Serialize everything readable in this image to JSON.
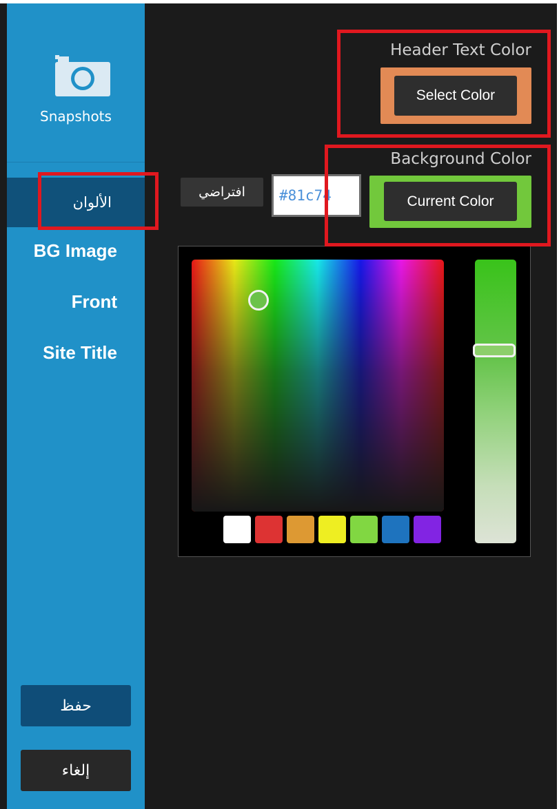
{
  "sidebar": {
    "snapshots_label": "Snapshots",
    "items": [
      {
        "label": "الألوان",
        "active": true
      },
      {
        "label": "BG Image",
        "active": false
      },
      {
        "label": "Front",
        "active": false
      },
      {
        "label": "Site Title",
        "active": false
      }
    ],
    "save_label": "حفظ",
    "cancel_label": "إلغاء"
  },
  "header_text_color": {
    "label": "Header Text Color",
    "button_label": "Select Color",
    "color": "#e28a55"
  },
  "background_color": {
    "label": "Background Color",
    "button_label": "Current Color",
    "color": "#72c83c",
    "default_label": "افتراضي",
    "hex_value": "#81c74"
  },
  "picker": {
    "selected_color": "#6bc24a",
    "swatches": [
      "#000000",
      "#ffffff",
      "#dd3333",
      "#dd9933",
      "#eeee22",
      "#81d742",
      "#1e73be",
      "#8224e3"
    ]
  },
  "colors": {
    "sidebar_bg": "#2091c8",
    "sidebar_active": "#10517a",
    "panel_bg": "#1b1b1b",
    "highlight_box": "#e0181f"
  },
  "icons": {
    "camera": "camera-icon"
  }
}
